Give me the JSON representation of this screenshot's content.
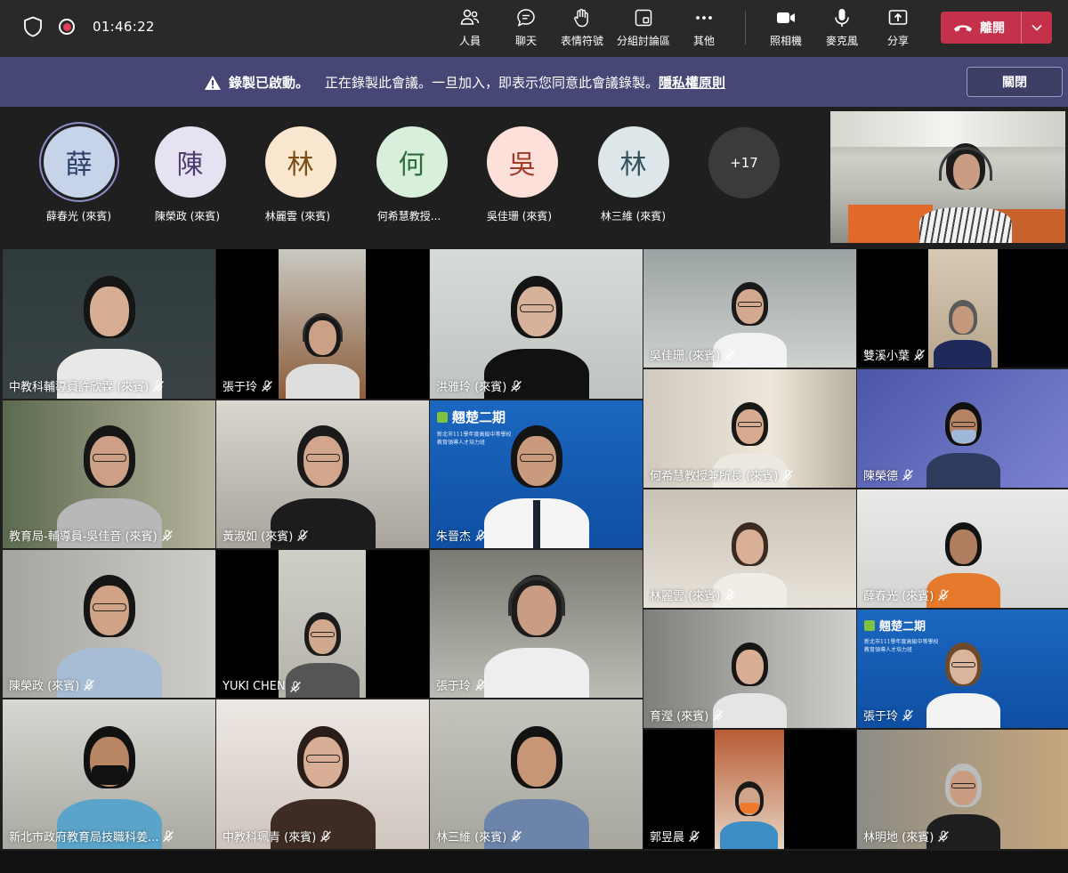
{
  "toolbar": {
    "timer": "01:46:22",
    "buttons": [
      {
        "label": "人員"
      },
      {
        "label": "聊天"
      },
      {
        "label": "表情符號"
      },
      {
        "label": "分組討論區"
      },
      {
        "label": "其他"
      },
      {
        "label": "照相機"
      },
      {
        "label": "麥克風"
      },
      {
        "label": "分享"
      }
    ],
    "leave_label": "離開"
  },
  "banner": {
    "title": "錄製已啟動。",
    "message": "正在錄製此會議。一旦加入，即表示您同意此會議錄製。",
    "link": "隱私權原則",
    "close_label": "關閉"
  },
  "strip": {
    "participants": [
      {
        "initial": "薛",
        "name": "薛春光 (來賓)",
        "color": "#c7d3e8",
        "text": "#2b3f66",
        "muted": false
      },
      {
        "initial": "陳",
        "name": "陳榮政 (來賓)",
        "color": "#e6e2f2",
        "text": "#4a3f6e",
        "muted": true
      },
      {
        "initial": "林",
        "name": "林麗雲 (來賓)",
        "color": "#fbe7cf",
        "text": "#7a4e16",
        "muted": true
      },
      {
        "initial": "何",
        "name": "何希慧教授...",
        "color": "#d8efdc",
        "text": "#2c6b3a",
        "muted": true
      },
      {
        "initial": "吳",
        "name": "吳佳珊 (來賓)",
        "color": "#fde0da",
        "text": "#a33b2a",
        "muted": true
      },
      {
        "initial": "林",
        "name": "林三維 (來賓)",
        "color": "#dde6e8",
        "text": "#35525a",
        "muted": false
      }
    ],
    "more_label": "+17"
  },
  "grid": {
    "tiles": [
      {
        "label": "中教科輔導員許欣霖 (來賓)"
      },
      {
        "label": "張于玲"
      },
      {
        "label": "洪雅玲 (來賓)"
      },
      {
        "label": "吳佳珊 (來賓)"
      },
      {
        "label": "雙溪小葉"
      },
      {
        "label": "何希慧教授兼所長 (來賓)"
      },
      {
        "label": "陳榮德"
      },
      {
        "label": "教育局-輔導員-吳佳音 (來賓)"
      },
      {
        "label": "黃淑如 (來賓)"
      },
      {
        "label": "朱晉杰"
      },
      {
        "label": "林麗雲 (來賓)"
      },
      {
        "label": "薛春光 (來賓)"
      },
      {
        "label": "陳榮政 (來賓)"
      },
      {
        "label": "YUKI CHEN"
      },
      {
        "label": "張于玲"
      },
      {
        "label": "育瀅 (來賓)"
      },
      {
        "label": "張于玲"
      },
      {
        "label": "新北市政府教育局技職科姜..."
      },
      {
        "label": "中教科珮青 (來賓)"
      },
      {
        "label": "林三維 (來賓)"
      },
      {
        "label": "郭昱晨"
      },
      {
        "label": "林明地 (來賓)"
      }
    ],
    "banner_text_1": "翹楚二期",
    "banner_text_2": "新北市111學年度高級中等學校",
    "banner_text_3": "教育領導人才培力班",
    "banner_text_4": "翹楚二期",
    "banner_text_5": "新北市111學年度高級中等學校",
    "banner_text_6": "教育領導人才培力班"
  },
  "colors": {
    "toolbar_bg": "#292929",
    "banner_bg": "#464775",
    "leave_red": "#c4314b",
    "stage_bg": "#1f1f1f"
  }
}
